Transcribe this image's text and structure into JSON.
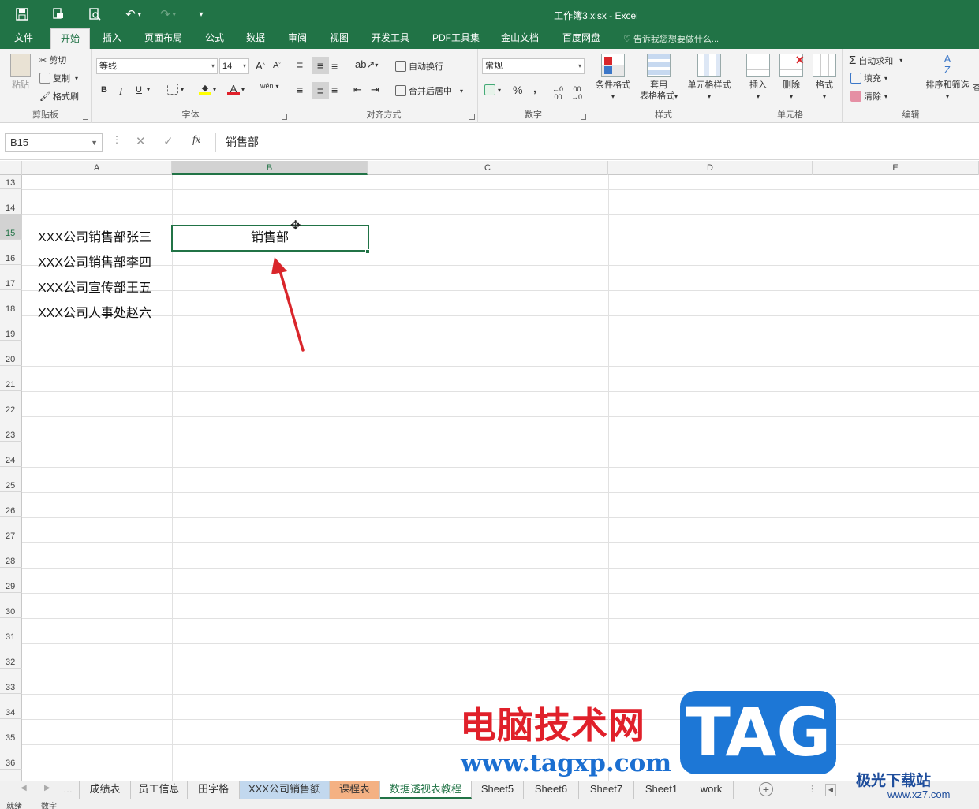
{
  "window": {
    "title": "工作簿3.xlsx - Excel"
  },
  "colors": {
    "brand": "#217346",
    "arrow": "#d9262b",
    "selection": "#217346"
  },
  "qat": {
    "save_icon": "save-icon",
    "print_preview_icon": "print-icon",
    "undo_icon": "undo-icon",
    "redo_icon": "redo-icon"
  },
  "ribbon_tabs": [
    "文件",
    "开始",
    "插入",
    "页面布局",
    "公式",
    "数据",
    "审阅",
    "视图",
    "开发工具",
    "PDF工具集",
    "金山文档",
    "百度网盘"
  ],
  "tell_me": "告诉我您想要做什么...",
  "ribbon": {
    "clipboard": {
      "label": "剪贴板",
      "paste": "粘贴",
      "cut": "剪切",
      "copy": "复制",
      "format_painter": "格式刷"
    },
    "font": {
      "label": "字体",
      "font_name": "等线",
      "font_size": "14",
      "bold": "B",
      "italic": "I",
      "underline": "U",
      "phonetic": "wén"
    },
    "alignment": {
      "label": "对齐方式",
      "wrap_text": "自动换行",
      "merge_center": "合并后居中"
    },
    "number": {
      "label": "数字",
      "format": "常规",
      "percent": "%",
      "comma": ","
    },
    "styles": {
      "label": "样式",
      "conditional": "条件格式",
      "table_format_1": "套用",
      "table_format_2": "表格格式",
      "cell_styles": "单元格样式"
    },
    "cells": {
      "label": "单元格",
      "insert": "插入",
      "delete": "删除",
      "format": "格式"
    },
    "editing": {
      "label": "编辑",
      "autosum": "自动求和",
      "fill": "填充",
      "clear": "清除",
      "sort_filter": "排序和筛选",
      "find": "查"
    }
  },
  "formula_bar": {
    "name_box": "B15",
    "content": "销售部",
    "fx": "fx"
  },
  "columns": [
    "A",
    "B",
    "C",
    "D",
    "E"
  ],
  "selected_column": "B",
  "rows": [
    "13",
    "14",
    "15",
    "16",
    "17",
    "18",
    "19",
    "20",
    "21",
    "22",
    "23",
    "24",
    "25",
    "26",
    "27",
    "28",
    "29",
    "30",
    "31",
    "32",
    "33",
    "34",
    "35",
    "36"
  ],
  "selected_row": "15",
  "cells": {
    "A15": "XXX公司销售部张三",
    "A16": "XXX公司销售部李四",
    "A17": "XXX公司宣传部王五",
    "A18": "XXX公司人事处赵六",
    "B15": "销售部"
  },
  "sheet_tabs": [
    "成绩表",
    "员工信息",
    "田字格",
    "XXX公司销售额",
    "课程表",
    "数据透视表教程",
    "Sheet5",
    "Sheet6",
    "Sheet7",
    "Sheet1",
    "work"
  ],
  "active_sheet": "数据透视表教程",
  "status": {
    "ready": "就绪",
    "num": "数字"
  },
  "watermark": {
    "cn": "电脑技术网",
    "url": "www.tagxp.com",
    "tag": "TAG",
    "xz": "极光下载站",
    "xz_url": "www.xz7.com"
  }
}
